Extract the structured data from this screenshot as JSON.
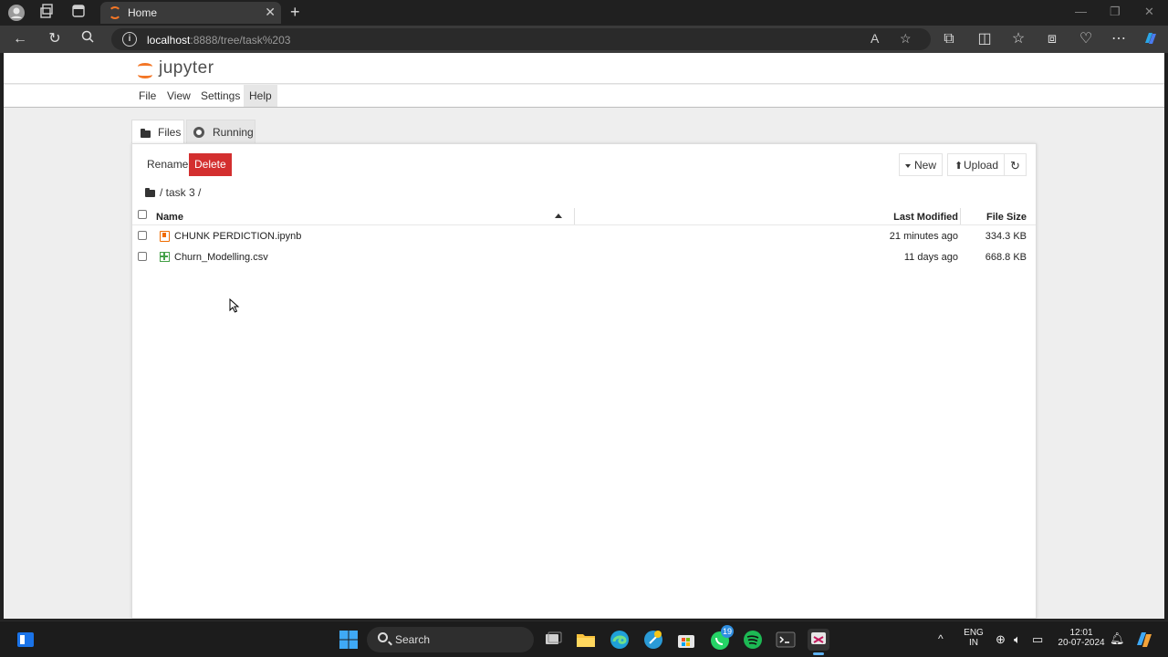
{
  "browser": {
    "tab_title": "Home",
    "url_host": "localhost",
    "url_path": ":8888/tree/task%203"
  },
  "jupyter": {
    "logo_text": "jupyter",
    "menu": [
      "File",
      "View",
      "Settings",
      "Help"
    ],
    "tabs": {
      "files": "Files",
      "running": "Running"
    },
    "toolbar": {
      "rename": "Rename",
      "delete": "Delete",
      "new": "New",
      "upload": "Upload"
    },
    "breadcrumb": "/ task 3 /",
    "columns": {
      "name": "Name",
      "last_modified": "Last Modified",
      "file_size": "File Size"
    },
    "files": [
      {
        "name": "CHUNK PERDICTION.ipynb",
        "type": "notebook",
        "modified": "21 minutes ago",
        "size": "334.3 KB"
      },
      {
        "name": "Churn_Modelling.csv",
        "type": "csv",
        "modified": "11 days ago",
        "size": "668.8 KB"
      }
    ]
  },
  "taskbar": {
    "search_label": "Search",
    "whatsapp_badge": "19",
    "lang_line1": "ENG",
    "lang_line2": "IN",
    "time": "12:01",
    "date": "20-07-2024"
  },
  "colors": {
    "jupyter_orange": "#f37626",
    "delete_red": "#d32f2f"
  }
}
